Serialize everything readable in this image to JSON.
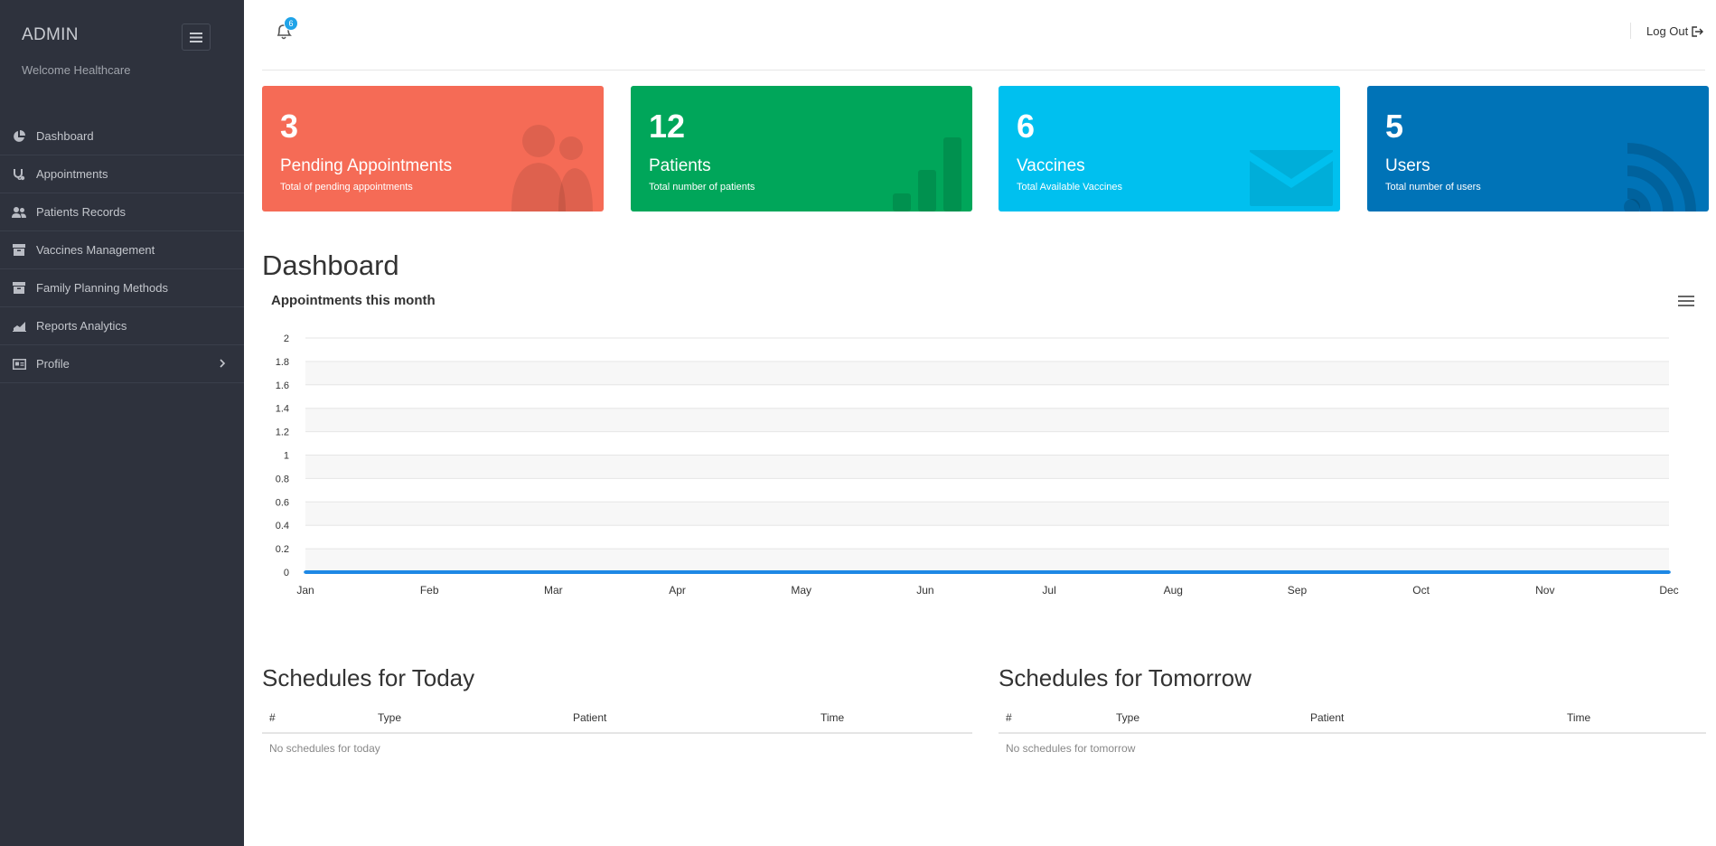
{
  "sidebar": {
    "brand": "ADMIN",
    "welcome": "Welcome Healthcare",
    "toggle_icon": "hamburger-icon",
    "items": [
      {
        "label": "Dashboard",
        "icon": "pie-chart-icon"
      },
      {
        "label": "Appointments",
        "icon": "stethoscope-icon"
      },
      {
        "label": "Patients Records",
        "icon": "users-icon"
      },
      {
        "label": "Vaccines Management",
        "icon": "archive-icon"
      },
      {
        "label": "Family Planning Methods",
        "icon": "archive-icon"
      },
      {
        "label": "Reports Analytics",
        "icon": "area-chart-icon"
      },
      {
        "label": "Profile",
        "icon": "id-card-icon",
        "chevron": "chevron-right-icon"
      }
    ]
  },
  "topbar": {
    "notification_count": "6",
    "logout_label": "Log Out"
  },
  "cards": [
    {
      "value": "3",
      "title": "Pending Appointments",
      "subtitle": "Total of pending appointments",
      "color": "#f56b56",
      "icon": "users-icon"
    },
    {
      "value": "12",
      "title": "Patients",
      "subtitle": "Total number of patients",
      "color": "#00a65a",
      "icon": "bar-chart-icon"
    },
    {
      "value": "6",
      "title": "Vaccines",
      "subtitle": "Total Available Vaccines",
      "color": "#00c0ef",
      "icon": "envelope-icon"
    },
    {
      "value": "5",
      "title": "Users",
      "subtitle": "Total number of users",
      "color": "#0073b7",
      "icon": "rss-icon"
    }
  ],
  "dashboard_title": "Dashboard",
  "chart_data": {
    "type": "line",
    "title": "Appointments this month",
    "categories": [
      "Jan",
      "Feb",
      "Mar",
      "Apr",
      "May",
      "Jun",
      "Jul",
      "Aug",
      "Sep",
      "Oct",
      "Nov",
      "Dec"
    ],
    "series": [
      {
        "values": [
          0,
          0,
          0,
          0,
          0,
          0,
          0,
          0,
          0,
          0,
          0,
          0
        ],
        "color": "#1e88e5"
      }
    ],
    "yticks": [
      "0",
      "0.2",
      "0.4",
      "0.6",
      "0.8",
      "1",
      "1.2",
      "1.4",
      "1.6",
      "1.8",
      "2"
    ],
    "ylim": [
      0,
      2
    ],
    "grid": true,
    "xlabel": "",
    "ylabel": ""
  },
  "schedules": {
    "today": {
      "title": "Schedules for Today",
      "columns": [
        "#",
        "Type",
        "Patient",
        "Time"
      ],
      "empty_text": "No schedules for today"
    },
    "tomorrow": {
      "title": "Schedules for Tomorrow",
      "columns": [
        "#",
        "Type",
        "Patient",
        "Time"
      ],
      "empty_text": "No schedules for tomorrow"
    }
  }
}
